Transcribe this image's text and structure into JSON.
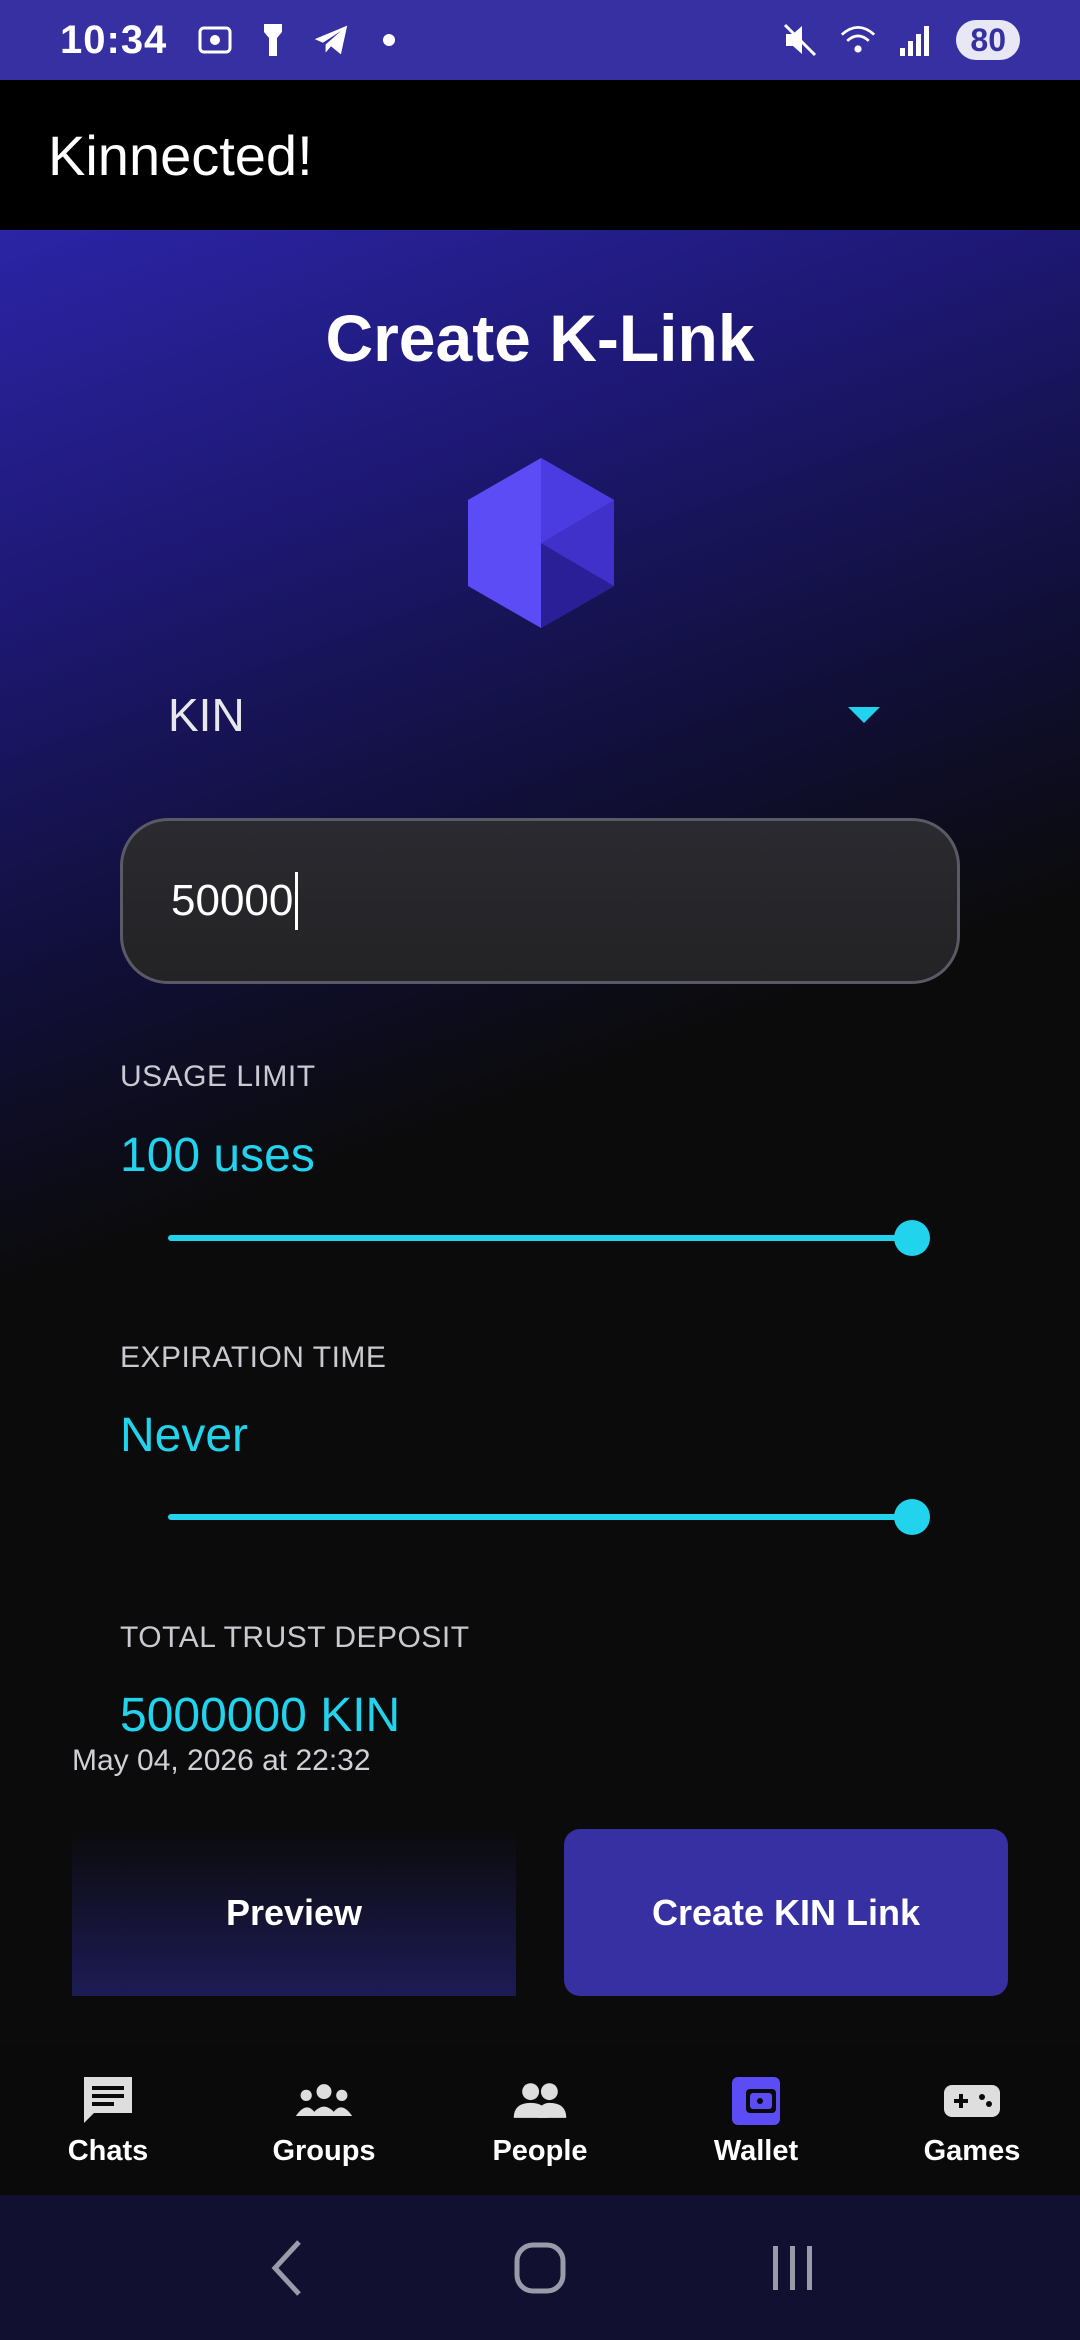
{
  "status_bar": {
    "time": "10:34",
    "battery": "80",
    "icons": [
      "screenshot-icon",
      "flashlight-icon",
      "telegram-icon",
      "dot-icon",
      "mute-icon",
      "wifi-icon",
      "signal-icon"
    ]
  },
  "app_bar": {
    "title": "Kinnected!"
  },
  "page": {
    "title": "Create K-Link",
    "currency": {
      "selected": "KIN"
    },
    "amount": {
      "value": "50000"
    },
    "usage_limit": {
      "label": "USAGE LIMIT",
      "value": "100 uses",
      "level": 1.0
    },
    "expiration": {
      "label": "EXPIRATION TIME",
      "value": "Never",
      "level": 1.0
    },
    "total_deposit": {
      "label": "TOTAL TRUST DEPOSIT",
      "value": "5000000 KIN"
    },
    "date": "May 04, 2026 at 22:32",
    "buttons": {
      "preview": "Preview",
      "create": "Create KIN Link"
    }
  },
  "colors": {
    "accent": "#22d3ee",
    "primary": "#3730a3",
    "logo": "#5b4cf5"
  },
  "bottom_nav": {
    "items": [
      {
        "label": "Chats",
        "icon": "chat-icon"
      },
      {
        "label": "Groups",
        "icon": "groups-icon"
      },
      {
        "label": "People",
        "icon": "people-icon"
      },
      {
        "label": "Wallet",
        "icon": "wallet-icon"
      },
      {
        "label": "Games",
        "icon": "gamepad-icon"
      }
    ]
  }
}
